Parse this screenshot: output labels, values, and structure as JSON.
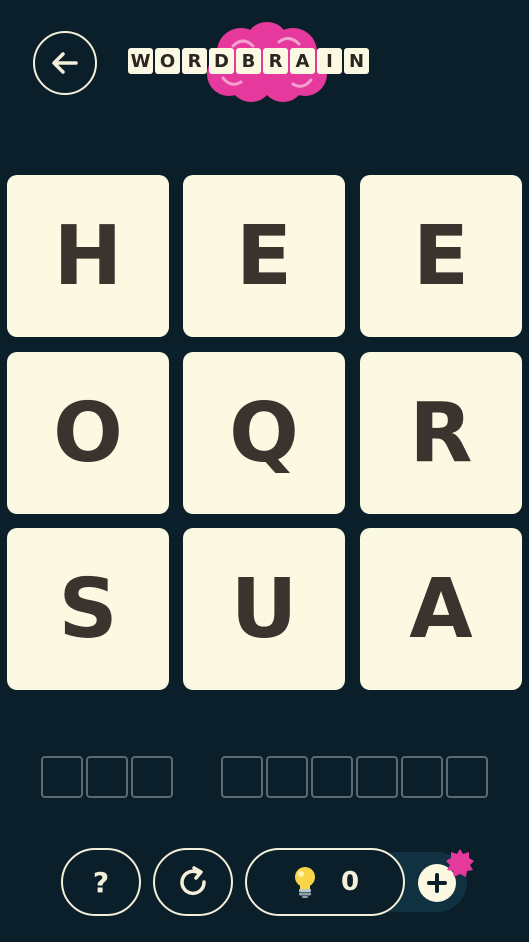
{
  "header": {
    "logo_letters": [
      "W",
      "O",
      "R",
      "D",
      "B",
      "R",
      "A",
      "I",
      "N"
    ],
    "brain_color": "#e5399d"
  },
  "grid": {
    "letters": [
      "H",
      "E",
      "E",
      "O",
      "Q",
      "R",
      "S",
      "U",
      "A"
    ]
  },
  "answer": {
    "word_lengths": [
      3,
      6
    ]
  },
  "toolbar": {
    "help_label": "?",
    "hint_count": "0",
    "plus_label": "+"
  },
  "colors": {
    "background": "#0b1f2a",
    "tile": "#fcf9e3",
    "tile_text": "#3b342e",
    "accent_pink": "#e5399d",
    "bulb_yellow": "#f8d548"
  }
}
